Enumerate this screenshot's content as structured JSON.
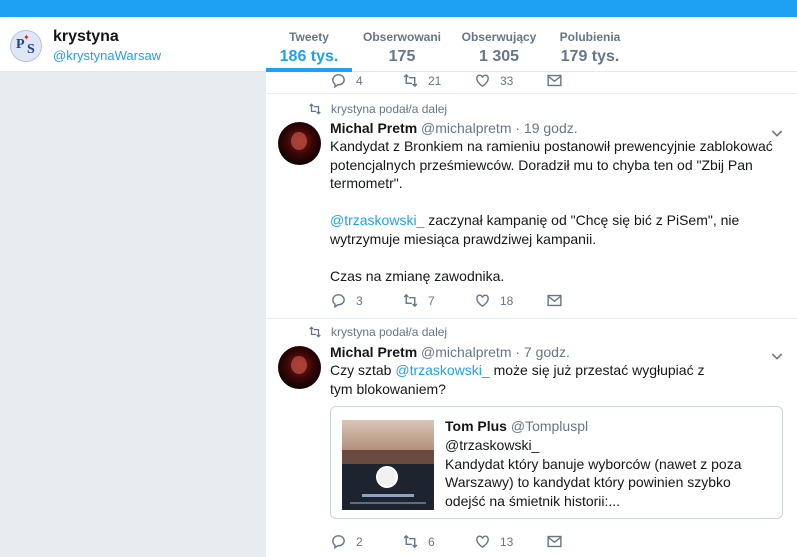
{
  "profile": {
    "name": "krystyna",
    "handle": "@krystynaWarsaw"
  },
  "stats": [
    {
      "label": "Tweety",
      "value": "186 tys."
    },
    {
      "label": "Obserwowani",
      "value": "175"
    },
    {
      "label": "Obserwujący",
      "value": "1 305"
    },
    {
      "label": "Polubienia",
      "value": "179 tys."
    }
  ],
  "active_stat": "Tweety",
  "colors": {
    "accent": "#1da1f2",
    "muted": "#657786",
    "background": "#e6ecf0"
  },
  "top_actions": {
    "replies": "4",
    "retweets": "21",
    "likes": "33"
  },
  "tweets": [
    {
      "retweet_note": "krystyna podał/a dalej",
      "author_name": "Michal Pretm",
      "author_handle": "@michalpretm",
      "time": "· 19 godz.",
      "text_1": "Kandydat z Bronkiem na ramieniu postanowił prewencyjnie zablokować potencjalnych prześmiewców. Doradził mu to chyba ten od \"Zbij Pan termometr\".",
      "mention": "@trzaskowski_",
      "text_2": " zaczynał kampanię od \"Chcę się bić z PiSem\", nie wytrzymuje miesiąca prawdziwej kampanii.",
      "text_3": "Czas na zmianę zawodnika.",
      "replies": "3",
      "retweets": "7",
      "likes": "18"
    },
    {
      "retweet_note": "krystyna podał/a dalej",
      "author_name": "Michal Pretm",
      "author_handle": "@michalpretm",
      "time": "· 7 godz.",
      "text_before": "Czy sztab ",
      "mention": "@trzaskowski_",
      "text_after": " może się już przestać wygłupiać z tym blokowaniem?",
      "quote": {
        "author_name": "Tom Plus",
        "author_handle": "@Tompluspl",
        "text_1": "@trzaskowski_",
        "text_2": "Kandydat który banuje wyborców (nawet z poza Warszawy) to kandydat który powinien szybko odejść na śmietnik historii:..."
      },
      "replies": "2",
      "retweets": "6",
      "likes": "13"
    }
  ]
}
